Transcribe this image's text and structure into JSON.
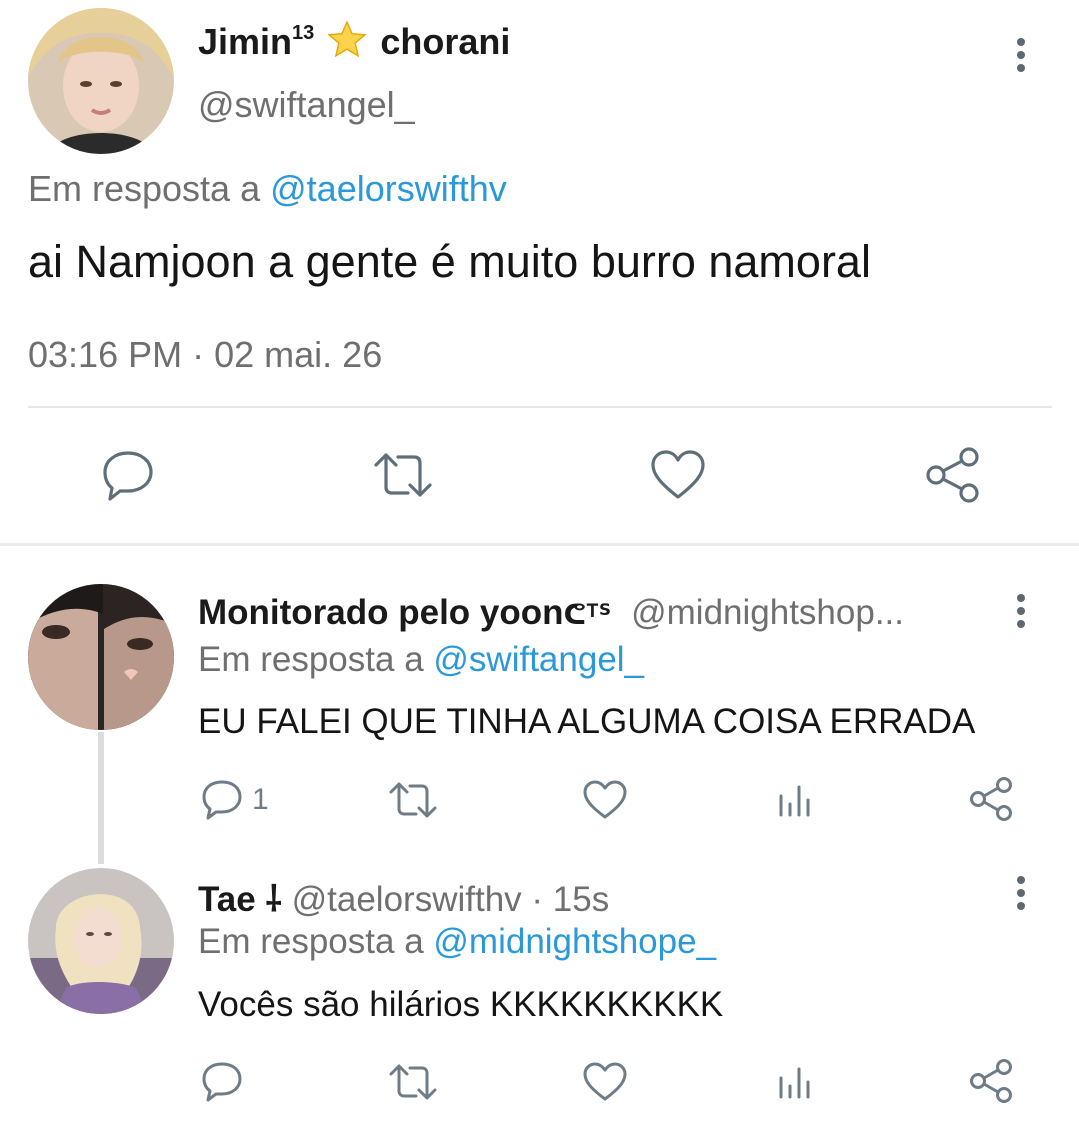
{
  "main_tweet": {
    "display_name": "Jimin",
    "superscript": "13",
    "name_suffix": "chorani",
    "handle": "@swiftangel_",
    "reply_prefix": "Em resposta a",
    "reply_to": "@taelorswifthv",
    "text": "ai Namjoon a gente é muito burro namoral",
    "time": "03:16 PM",
    "separator": "·",
    "date": "02 mai. 26",
    "actions": [
      "reply-icon",
      "retweet-icon",
      "like-icon",
      "share-icon"
    ]
  },
  "replies": [
    {
      "display_name": "Monitorado pelo yoon",
      "name_symbol": "ᕦᵀᔆ",
      "handle": "@midnightshop...",
      "reply_prefix": "Em resposta a",
      "reply_to": "@swiftangel_",
      "text": "EU FALEI QUE TINHA ALGUMA COISA ERRADA",
      "reply_count": "1",
      "actions": [
        "reply-icon",
        "retweet-icon",
        "like-icon",
        "views-icon",
        "share-icon"
      ]
    },
    {
      "display_name": "Tae",
      "name_symbol": "⸸",
      "handle": "@taelorswifthv",
      "separator": "·",
      "time": "15s",
      "reply_prefix": "Em resposta a",
      "reply_to": "@midnightshope_",
      "text": "Vocês são hilários KKKKKKKKKK",
      "actions": [
        "reply-icon",
        "retweet-icon",
        "like-icon",
        "views-icon",
        "share-icon"
      ]
    }
  ],
  "colors": {
    "link": "#2a99dc",
    "muted": "#6f6f6f",
    "icon": "#5f6f7a",
    "divider": "#e6e6e6"
  }
}
